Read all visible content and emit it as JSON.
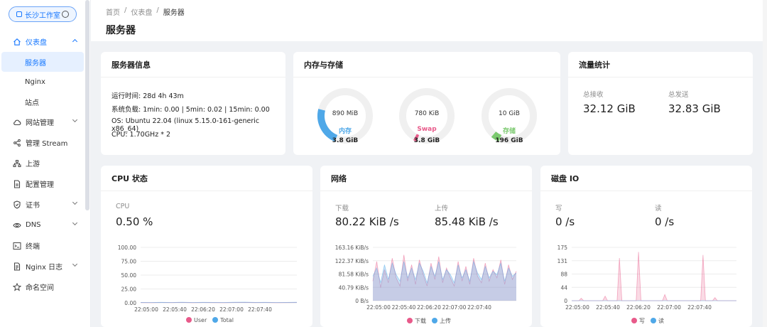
{
  "sidebar": {
    "env_label": "长沙工作室",
    "items": [
      {
        "label": "仪表盘",
        "icon": "home-icon",
        "open": true,
        "children": [
          {
            "label": "服务器",
            "active": true
          },
          {
            "label": "Nginx",
            "active": false
          },
          {
            "label": "站点",
            "active": false
          }
        ]
      },
      {
        "label": "网站管理",
        "icon": "cloud-icon",
        "expandable": true
      },
      {
        "label": "管理 Stream",
        "icon": "share-icon"
      },
      {
        "label": "上游",
        "icon": "cluster-icon"
      },
      {
        "label": "配置管理",
        "icon": "file-icon"
      },
      {
        "label": "证书",
        "icon": "shield-icon",
        "expandable": true
      },
      {
        "label": "DNS",
        "icon": "eye-icon",
        "expandable": true
      },
      {
        "label": "终端",
        "icon": "terminal-icon"
      },
      {
        "label": "Nginx 日志",
        "icon": "log-file-icon",
        "expandable": true
      },
      {
        "label": "命名空间",
        "icon": "star-icon"
      }
    ]
  },
  "header": {
    "breadcrumb": [
      "首页",
      "仪表盘",
      "服务器"
    ],
    "title": "服务器"
  },
  "server_info": {
    "title": "服务器信息",
    "uptime": "运行时间: 28d 4h 43m",
    "load": "系统负载: 1min: 0.00 | 5min: 0.02 | 15min: 0.00",
    "os": "OS: Ubuntu 22.04 (linux 5.15.0-161-generic x86_64)",
    "cpu": "CPU: 1.70GHz * 2"
  },
  "memory": {
    "title": "内存与存储",
    "gauges": [
      {
        "value": "890 MiB",
        "label": "内存",
        "total": "3.8 GiB",
        "percent": 22.9,
        "color": "#4fa8e8"
      },
      {
        "value": "780 KiB",
        "label": "Swap",
        "total": "3.8 GiB",
        "percent": 0.02,
        "color": "#e85a8a"
      },
      {
        "value": "10 GiB",
        "label": "存储",
        "total": "196 GiB",
        "percent": 5.1,
        "color": "#7bc96f"
      }
    ]
  },
  "traffic": {
    "title": "流量统计",
    "recv_label": "总接收",
    "recv_value": "32.12 GiB",
    "send_label": "总发送",
    "send_value": "32.83 GiB"
  },
  "cpu_card": {
    "title": "CPU 状态",
    "label": "CPU",
    "value": "0.50 %",
    "legend": [
      "User",
      "Total"
    ]
  },
  "net_card": {
    "title": "网络",
    "down_label": "下载",
    "down_value": "80.22 KiB /s",
    "up_label": "上传",
    "up_value": "85.48 KiB /s",
    "legend": [
      "下载",
      "上传"
    ]
  },
  "disk_card": {
    "title": "磁盘 IO",
    "write_label": "写",
    "write_value": "0 /s",
    "read_label": "读",
    "read_value": "0 /s",
    "legend": [
      "写",
      "读"
    ]
  },
  "chart_data": [
    {
      "type": "area",
      "name": "cpu",
      "x": [
        "22:05:00",
        "22:05:40",
        "22:06:20",
        "22:07:00",
        "22:07:40"
      ],
      "y_ticks": [
        "100.00",
        "75.00",
        "50.00",
        "25.00",
        "0.00"
      ],
      "ylim": [
        0,
        100
      ],
      "series": [
        {
          "name": "User",
          "color": "#e85a8a",
          "values": [
            0.4,
            0.3,
            0.5,
            0.4,
            0.6,
            0.3,
            0.5,
            0.4,
            0.3,
            0.5,
            0.6,
            0.4,
            0.5,
            0.3,
            0.4,
            0.5
          ]
        },
        {
          "name": "Total",
          "color": "#4fa8e8",
          "values": [
            0.8,
            0.6,
            0.9,
            0.7,
            1.2,
            0.6,
            0.9,
            0.8,
            0.7,
            1.0,
            1.3,
            0.8,
            0.9,
            0.6,
            0.8,
            1.0
          ]
        }
      ]
    },
    {
      "type": "area",
      "name": "network",
      "x": [
        "22:05:00",
        "22:05:40",
        "22:06:20",
        "22:07:00",
        "22:07:40"
      ],
      "y_ticks": [
        "163.16 KiB/s",
        "122.37 KiB/s",
        "81.58 KiB/s",
        "40.79 KiB/s",
        "0 B/s"
      ],
      "ylim": [
        0,
        163.16
      ],
      "series": [
        {
          "name": "下载",
          "color": "#e85a8a",
          "values": [
            60,
            120,
            40,
            95,
            55,
            130,
            70,
            45,
            140,
            60,
            110,
            50,
            125,
            80,
            45,
            115,
            65,
            135,
            55,
            100,
            70,
            45,
            120,
            60,
            105,
            50,
            130,
            75,
            55,
            115,
            60,
            95,
            70,
            125,
            50,
            110,
            65,
            90
          ]
        },
        {
          "name": "上传",
          "color": "#4fa8e8",
          "values": [
            75,
            100,
            55,
            110,
            65,
            115,
            80,
            60,
            120,
            70,
            100,
            65,
            115,
            90,
            55,
            105,
            75,
            120,
            65,
            95,
            80,
            55,
            110,
            70,
            95,
            60,
            120,
            85,
            65,
            105,
            70,
            90,
            80,
            115,
            60,
            100,
            75,
            85
          ]
        }
      ]
    },
    {
      "type": "area",
      "name": "disk-io",
      "x": [
        "22:05:00",
        "22:05:40",
        "22:06:20",
        "22:07:00",
        "22:07:40"
      ],
      "y_ticks": [
        "175",
        "131",
        "88",
        "44",
        "0"
      ],
      "ylim": [
        0,
        175
      ],
      "series": [
        {
          "name": "写",
          "color": "#e85a8a",
          "values": [
            0,
            0,
            0,
            0,
            8,
            0,
            0,
            0,
            0,
            0,
            0,
            0,
            0,
            0,
            15,
            0,
            0,
            0,
            0,
            0,
            140,
            0,
            0,
            0,
            0,
            0,
            0,
            0,
            160,
            0,
            0,
            0,
            0,
            0,
            0,
            0,
            0,
            0,
            0,
            20,
            0,
            0,
            0,
            0,
            0,
            0,
            0,
            0,
            0,
            0,
            0,
            0,
            0,
            0,
            0,
            150,
            0,
            0,
            0,
            0,
            10,
            0,
            0,
            0,
            0,
            0,
            0,
            0,
            0,
            0
          ]
        },
        {
          "name": "读",
          "color": "#4fa8e8",
          "values": [
            0,
            0,
            0,
            0,
            0,
            0,
            0,
            0,
            0,
            0,
            0,
            0,
            0,
            0,
            0,
            0,
            0,
            0,
            0,
            0,
            0,
            0,
            0,
            0,
            0,
            0,
            0,
            0,
            0,
            0,
            0,
            0,
            0,
            0,
            0,
            0,
            0,
            0,
            0,
            0,
            0,
            0,
            0,
            0,
            0,
            0,
            0,
            0,
            0,
            0,
            0,
            0,
            0,
            0,
            0,
            0,
            0,
            0,
            0,
            0,
            0,
            0,
            0,
            0,
            0,
            0,
            0,
            0,
            0,
            0
          ]
        }
      ]
    }
  ]
}
